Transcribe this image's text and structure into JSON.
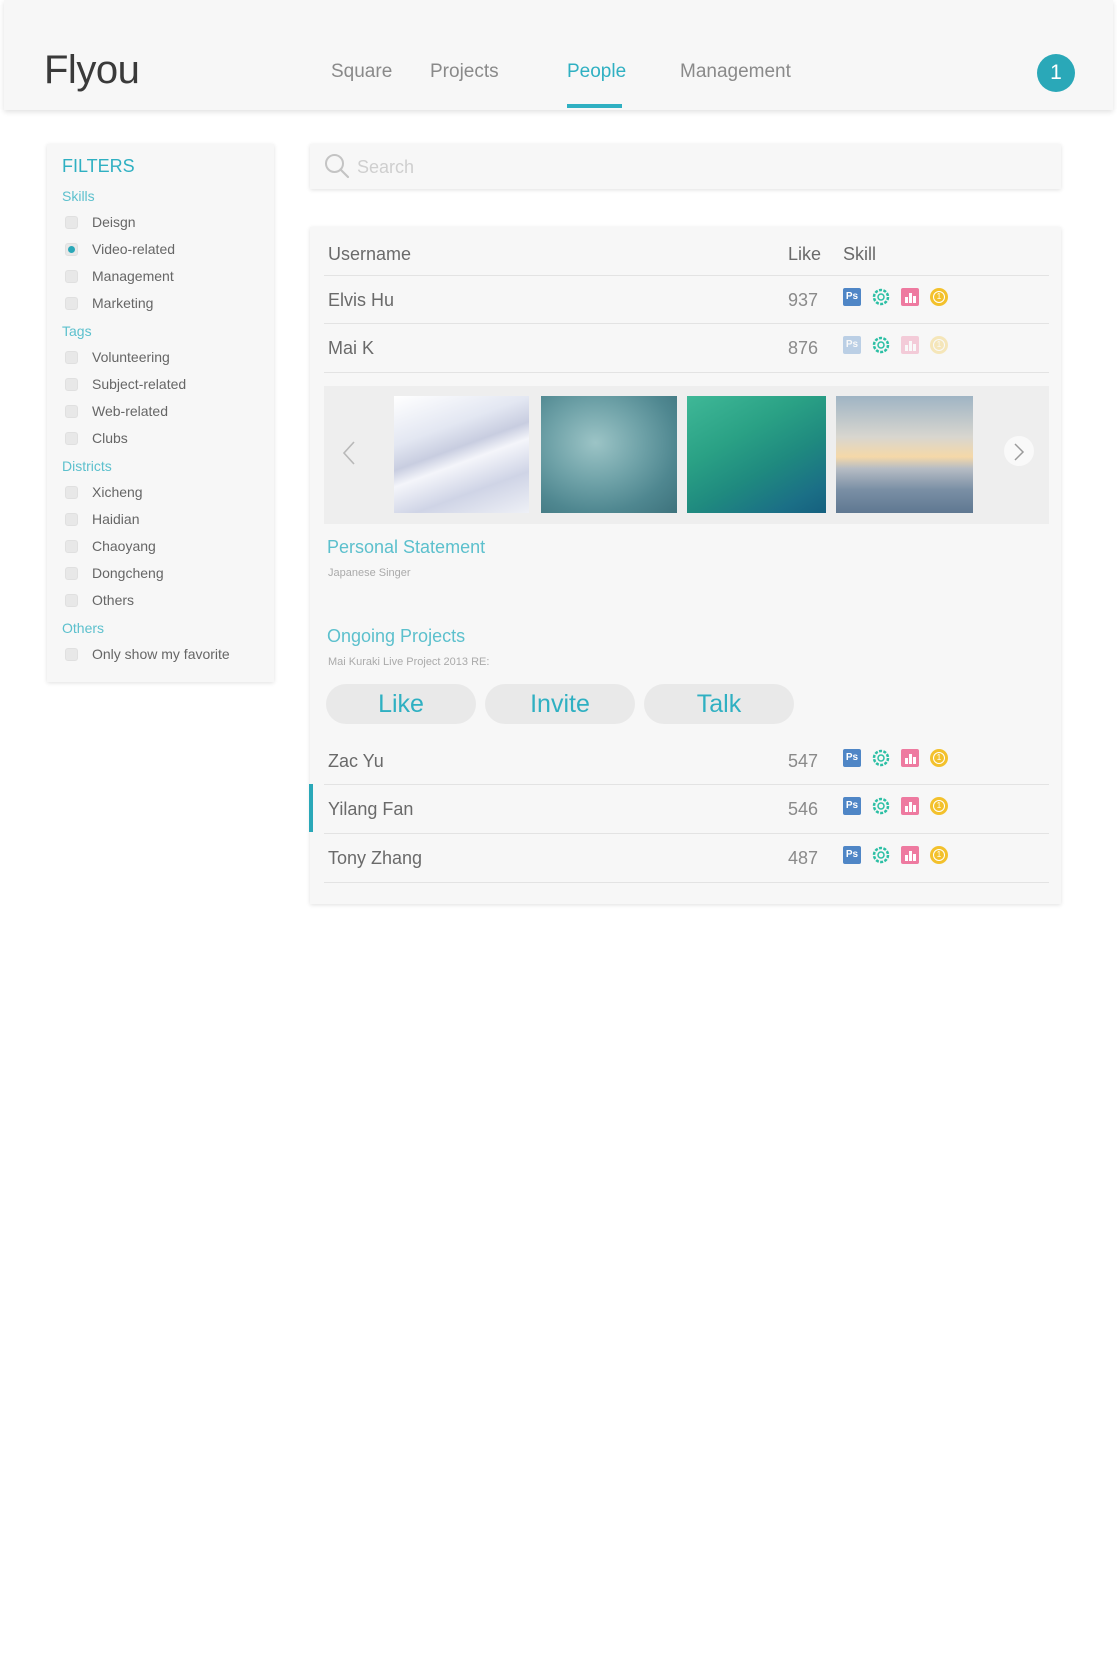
{
  "app": {
    "logo": "Flyou",
    "notification_count": "1"
  },
  "nav": {
    "items": [
      {
        "label": "Square",
        "active": false
      },
      {
        "label": "Projects",
        "active": false
      },
      {
        "label": "People",
        "active": true
      },
      {
        "label": "Management",
        "active": false
      }
    ]
  },
  "filters": {
    "title": "FILTERS",
    "groups": [
      {
        "label": "Skills",
        "options": [
          {
            "label": "Deisgn",
            "checked": false
          },
          {
            "label": "Video-related",
            "checked": true
          },
          {
            "label": "Management",
            "checked": false
          },
          {
            "label": "Marketing",
            "checked": false
          }
        ]
      },
      {
        "label": "Tags",
        "options": [
          {
            "label": "Volunteering",
            "checked": false
          },
          {
            "label": "Subject-related",
            "checked": false
          },
          {
            "label": "Web-related",
            "checked": false
          },
          {
            "label": "Clubs",
            "checked": false
          }
        ]
      },
      {
        "label": "Districts",
        "options": [
          {
            "label": "Xicheng",
            "checked": false
          },
          {
            "label": "Haidian",
            "checked": false
          },
          {
            "label": "Chaoyang",
            "checked": false
          },
          {
            "label": "Dongcheng",
            "checked": false
          },
          {
            "label": "Others",
            "checked": false
          }
        ]
      },
      {
        "label": "Others",
        "options": [
          {
            "label": "Only show my favorite",
            "checked": false
          }
        ]
      }
    ]
  },
  "search": {
    "placeholder": "Search",
    "value": ""
  },
  "table": {
    "columns": {
      "username": "Username",
      "like": "Like",
      "skill": "Skill"
    },
    "rows": [
      {
        "name": "Elvis Hu",
        "likes": "937"
      },
      {
        "name": "Mai K",
        "likes": "876",
        "expanded": true
      },
      {
        "name": "Zac Yu",
        "likes": "547"
      },
      {
        "name": "Yilang Fan",
        "likes": "546",
        "selected": true
      },
      {
        "name": "Tony Zhang",
        "likes": "487"
      }
    ],
    "skill_icons": [
      "photoshop-icon",
      "wheel-icon",
      "chart-icon",
      "coin-icon"
    ],
    "ps_label": "Ps"
  },
  "detail": {
    "statement_title": "Personal Statement",
    "statement_text": "Japanese Singer",
    "projects_title": "Ongoing Projects",
    "projects_text": "Mai Kuraki Live Project 2013 RE:",
    "actions": {
      "like": "Like",
      "invite": "Invite",
      "talk": "Talk"
    }
  },
  "colors": {
    "accent": "#2fb0c2",
    "photoshop": "#4f86c6",
    "wheel": "#2bbfa4",
    "chart": "#ee7aa0",
    "coin": "#f3c12c"
  }
}
